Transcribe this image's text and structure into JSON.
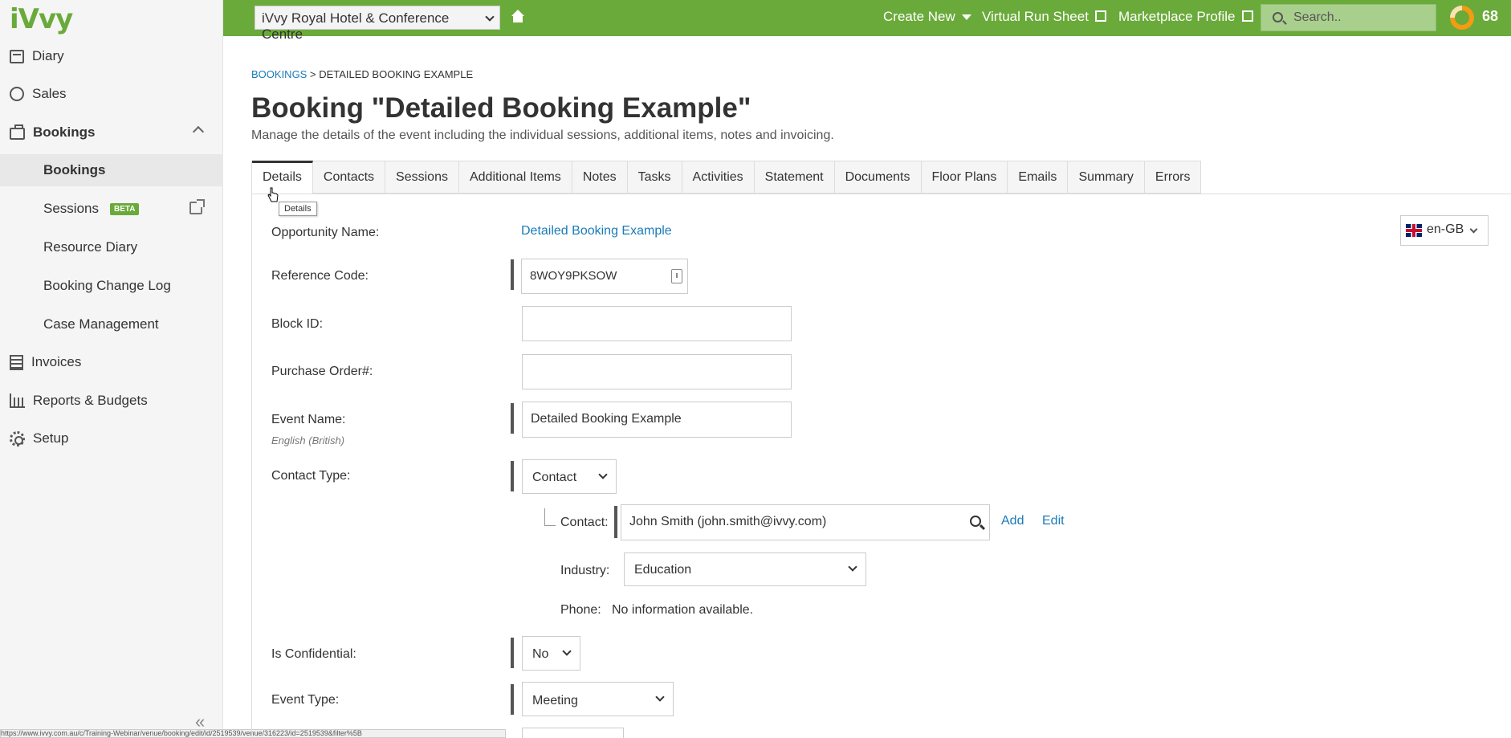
{
  "sidebar": {
    "logo": "iVvy",
    "items": [
      {
        "label": "Diary",
        "icon": "calendar-icon"
      },
      {
        "label": "Sales",
        "icon": "sales-icon"
      },
      {
        "label": "Bookings",
        "icon": "briefcase-icon"
      },
      {
        "label": "Bookings"
      },
      {
        "label": "Sessions",
        "badge": "BETA"
      },
      {
        "label": "Resource Diary"
      },
      {
        "label": "Booking Change Log"
      },
      {
        "label": "Case Management"
      },
      {
        "label": "Invoices",
        "icon": "calculator-icon"
      },
      {
        "label": "Reports & Budgets",
        "icon": "bar-chart-icon"
      },
      {
        "label": "Setup",
        "icon": "gear-icon"
      }
    ],
    "collapse_label": "«",
    "status_url": "https://www.ivvy.com.au/c/Training-Webinar/venue/booking/edit/id/2519539/venue/316223/id=2519539&filter%5B"
  },
  "topbar": {
    "venue": "iVvy Royal Hotel & Conference Centre",
    "create_new": "Create New",
    "virtual_run_sheet": "Virtual Run Sheet",
    "marketplace_profile": "Marketplace Profile",
    "search_placeholder": "Search..",
    "score": "68",
    "accent": "#6aaa3a"
  },
  "breadcrumb": {
    "root": "BOOKINGS",
    "sep": ">",
    "current": "DETAILED BOOKING EXAMPLE"
  },
  "page": {
    "title": "Booking \"Detailed Booking Example\"",
    "subtitle": "Manage the details of the event including the individual sessions, additional items, notes and invoicing."
  },
  "tabs": [
    "Details",
    "Contacts",
    "Sessions",
    "Additional Items",
    "Notes",
    "Tasks",
    "Activities",
    "Statement",
    "Documents",
    "Floor Plans",
    "Emails",
    "Summary",
    "Errors"
  ],
  "tooltip": "Details",
  "language": "en-GB",
  "form": {
    "opportunity_name_label": "Opportunity Name:",
    "opportunity_name_value": "Detailed Booking Example",
    "reference_code_label": "Reference Code:",
    "reference_code_value": "8WOY9PKSOW",
    "block_id_label": "Block ID:",
    "block_id_value": "",
    "purchase_order_label": "Purchase Order#:",
    "purchase_order_value": "",
    "event_name_label": "Event Name:",
    "event_name_hint": "English (British)",
    "event_name_value": "Detailed Booking Example",
    "contact_type_label": "Contact Type:",
    "contact_type_value": "Contact",
    "contact_label": "Contact:",
    "contact_value": "John Smith (john.smith@ivvy.com)",
    "add_label": "Add",
    "edit_label": "Edit",
    "industry_label": "Industry:",
    "industry_value": "Education",
    "phone_label": "Phone:",
    "phone_value": "No information available.",
    "confidential_label": "Is Confidential:",
    "confidential_value": "No",
    "event_type_label": "Event Type:",
    "event_type_value": "Meeting"
  }
}
